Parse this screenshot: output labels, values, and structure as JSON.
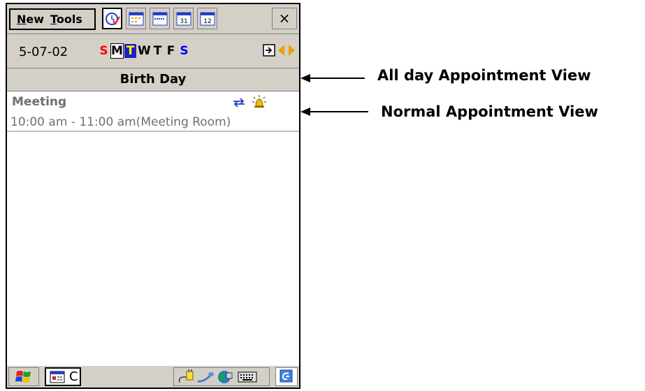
{
  "menu": {
    "new_label": "New",
    "tools_label": "Tools"
  },
  "toolbar": {
    "views": [
      "agenda-view-icon",
      "day-view-icon",
      "week-view-icon",
      "month-view-icon",
      "year-view-icon"
    ],
    "close_label": "×",
    "month_view_num": "31",
    "year_view_num": "12"
  },
  "datebar": {
    "date": "5-07-02",
    "days": [
      "S",
      "M",
      "T",
      "W",
      "T",
      "F",
      "S"
    ],
    "selected_day_index": 2
  },
  "allday": {
    "title": "Birth Day"
  },
  "appointment": {
    "title": "Meeting",
    "time": "10:00 am - 11:00 am(Meeting Room)"
  },
  "taskbar": {
    "app_label": "C"
  },
  "annotations": {
    "allday_label": "All day Appointment View",
    "normal_label": "Normal Appointment View"
  },
  "colors": {
    "chrome": "#d4d0c8",
    "weekend": "#ff0000",
    "sunday_blue": "#0000ff",
    "selected_bg": "#2020c0",
    "selected_fg": "#ffff00",
    "nav_arrow": "#f0a000"
  }
}
